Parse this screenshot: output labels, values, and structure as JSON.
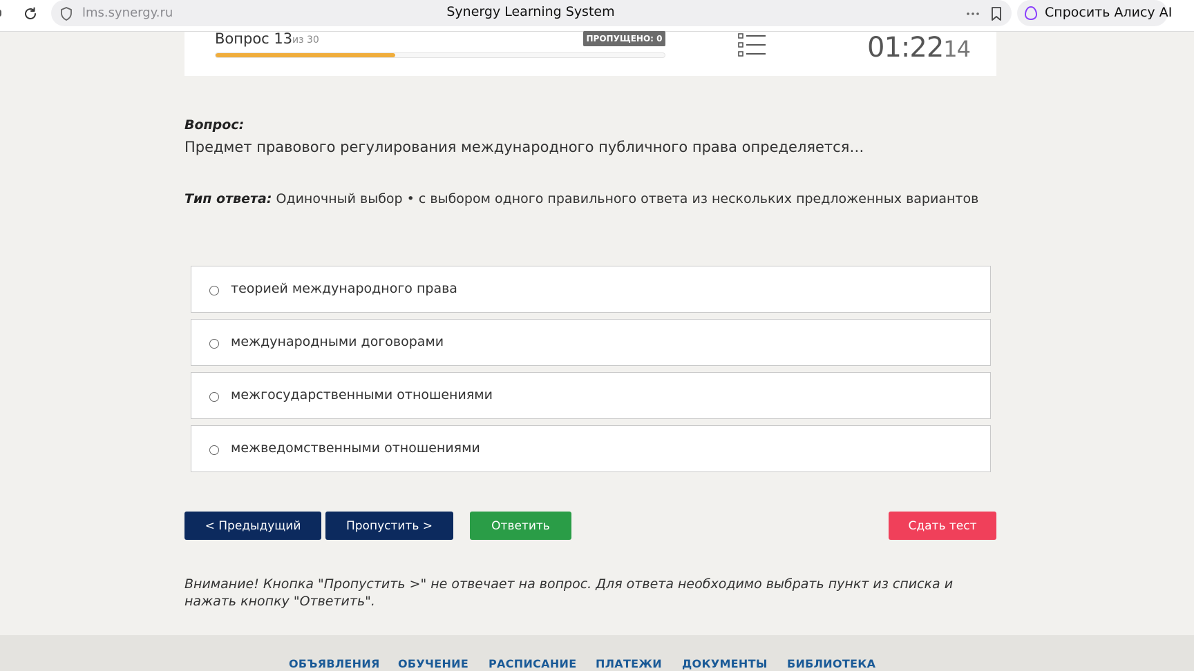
{
  "browser": {
    "url": "lms.synergy.ru",
    "title": "Synergy Learning System",
    "assistant_label": "Спросить Алису AI"
  },
  "test_header": {
    "question_label": "Вопрос 13",
    "of_label": "из 30",
    "skipped_badge": "ПРОПУЩЕНО: 0",
    "progress_fraction": 0.4,
    "timer_main": "01:22",
    "timer_seconds": "14",
    "progress_color": "#f0ad3c"
  },
  "question": {
    "label": "Вопрос:",
    "text": "Предмет правового регулирования международного публичного права определяется…",
    "answer_type_label": "Тип ответа:",
    "answer_type_value": " Одиночный выбор • с выбором одного правильного ответа из нескольких предложенных вариантов"
  },
  "options": [
    {
      "label": "теорией международного права",
      "selected": false
    },
    {
      "label": "международными договорами",
      "selected": false
    },
    {
      "label": "межгосударственными отношениями",
      "selected": false
    },
    {
      "label": "межведомственными отношениями",
      "selected": false
    }
  ],
  "buttons": {
    "prev": "< Предыдущий",
    "skip": "Пропустить >",
    "answer": "Ответить",
    "submit": "Сдать тест"
  },
  "warning_text": "Внимание! Кнопка \"Пропустить >\" не отвечает на вопрос. Для ответа необходимо выбрать пункт из списка и нажать кнопку \"Ответить\".",
  "footer_nav": [
    "ОБЪЯВЛЕНИЯ",
    "ОБУЧЕНИЕ",
    "РАСПИСАНИЕ",
    "ПЛАТЕЖИ",
    "ДОКУМЕНТЫ",
    "БИБЛИОТЕКА"
  ],
  "colors": {
    "primary_dark_blue": "#0c2a5e",
    "answer_green": "#2a9d47",
    "submit_red": "#f0405a",
    "footer_link": "#1a5a97",
    "page_bg": "#f2f1ee"
  }
}
